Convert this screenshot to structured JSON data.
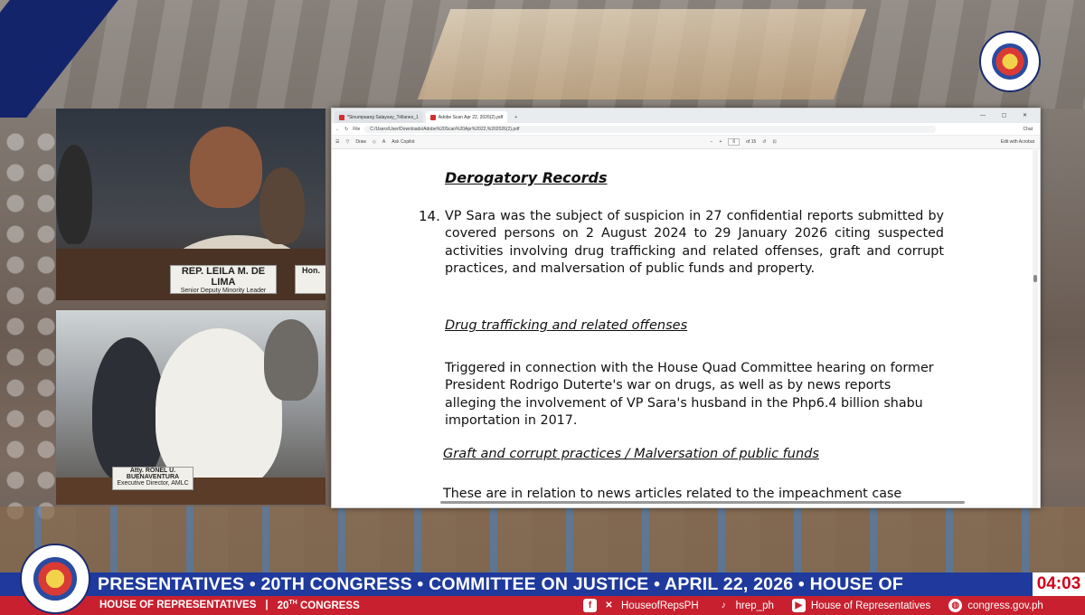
{
  "broadcast": {
    "ticker": "PRESENTATIVES  •  20TH CONGRESS  •  COMMITTEE ON JUSTICE  •  APRIL 22, 2026  •  HOUSE OF",
    "clock": "04:03",
    "footer_left_1": "HOUSE OF REPRESENTATIVES",
    "footer_sep": "|",
    "footer_left_2": "20",
    "footer_left_2_sup": "TH",
    "footer_left_2_end": " CONGRESS",
    "social_x": "HouseofRepsPH",
    "social_tiktok": "hrep_ph",
    "social_youtube": "House of Representatives",
    "website": "congress.gov.ph",
    "seal_text": "HOUSE OF REPRESENTATIVES • PHILIPPINES",
    "seal_year": "1907"
  },
  "video_feeds": {
    "top": {
      "nameplate_name": "REP. LEILA M. DE LIMA",
      "nameplate_title": "Senior Deputy Minority Leader",
      "side_nameplate": "Hon."
    },
    "bottom": {
      "nameplate_name": "Atty. RONEL U. BUENAVENTURA",
      "nameplate_title": "Executive Director, AMLC"
    }
  },
  "browser": {
    "tabs": [
      {
        "label": "*Sinumpaang Salaysay_Trillanes_1"
      },
      {
        "label": "Adobe Scan Apr 22, 2026(2).pdf"
      }
    ],
    "address": "C:/Users/User/Downloads/Adobe%20Scan%20Apr%2022,%202026(2).pdf",
    "address_prefix": "File",
    "toolbar": {
      "draw": "Draw",
      "ask_copilot": "Ask Copilot",
      "page_current": "6",
      "page_total": "of 15",
      "edit_acrobat": "Edit with Acrobat",
      "chat": "Chat"
    }
  },
  "document": {
    "heading": "Derogatory Records",
    "item_number": "14.",
    "item_text": "VP Sara was the subject of suspicion in 27 confidential reports submitted by covered persons on 2 August 2024 to 29 January 2026 citing suspected activities involving drug trafficking and related offenses, graft and corrupt practices, and malversation of public funds and property.",
    "section1_title": "Drug trafficking and related offenses",
    "section1_text": "Triggered in connection with the House Quad Committee hearing on former President Rodrigo Duterte's war on drugs, as well as by news reports alleging the involvement of VP Sara's husband in the Php6.4 billion shabu importation in 2017.",
    "section2_title": "Graft and corrupt practices / Malversation of public funds",
    "section2_text": "These are in relation to news articles related to the impeachment case"
  }
}
